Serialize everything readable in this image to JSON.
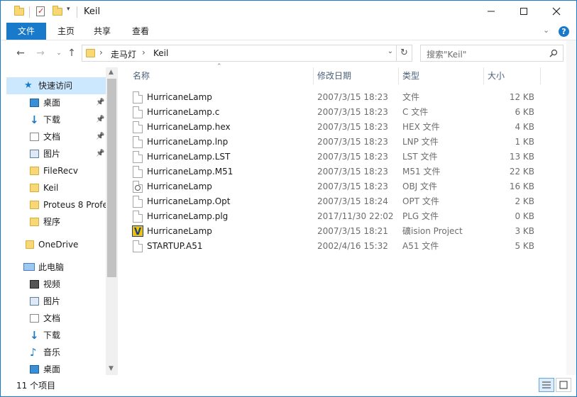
{
  "window": {
    "title": "Keil"
  },
  "ribbon": {
    "tabs": [
      "文件",
      "主页",
      "共享",
      "查看"
    ]
  },
  "address": {
    "segments": [
      "走马灯",
      "Keil"
    ]
  },
  "search": {
    "placeholder": "搜索\"Keil\""
  },
  "nav": {
    "quick_access": "快速访问",
    "items": [
      {
        "label": "桌面",
        "icon": "desktop-icon",
        "pinned": true
      },
      {
        "label": "下载",
        "icon": "download-icon",
        "pinned": true
      },
      {
        "label": "文档",
        "icon": "document-icon",
        "pinned": true
      },
      {
        "label": "图片",
        "icon": "picture-icon",
        "pinned": true
      },
      {
        "label": "FileRecv",
        "icon": "folder-icon",
        "pinned": false
      },
      {
        "label": "Keil",
        "icon": "folder-icon",
        "pinned": false
      },
      {
        "label": "Proteus 8 Profe",
        "icon": "folder-icon",
        "pinned": false
      },
      {
        "label": "程序",
        "icon": "folder-icon",
        "pinned": false
      }
    ],
    "onedrive": "OneDrive",
    "this_pc": "此电脑",
    "pc_items": [
      {
        "label": "视频",
        "icon": "video-icon"
      },
      {
        "label": "图片",
        "icon": "picture-icon"
      },
      {
        "label": "文档",
        "icon": "document-icon"
      },
      {
        "label": "下载",
        "icon": "download-icon"
      },
      {
        "label": "音乐",
        "icon": "music-icon"
      },
      {
        "label": "桌面",
        "icon": "desktop-icon"
      }
    ]
  },
  "columns": {
    "name": "名称",
    "date": "修改日期",
    "type": "类型",
    "size": "大小"
  },
  "files": [
    {
      "name": "HurricaneLamp",
      "date": "2007/3/15 18:23",
      "type": "文件",
      "size": "12 KB",
      "icon": "file-icon"
    },
    {
      "name": "HurricaneLamp.c",
      "date": "2007/3/15 18:23",
      "type": "C 文件",
      "size": "6 KB",
      "icon": "file-icon"
    },
    {
      "name": "HurricaneLamp.hex",
      "date": "2007/3/15 18:23",
      "type": "HEX 文件",
      "size": "4 KB",
      "icon": "file-icon"
    },
    {
      "name": "HurricaneLamp.lnp",
      "date": "2007/3/15 18:23",
      "type": "LNP 文件",
      "size": "1 KB",
      "icon": "file-icon"
    },
    {
      "name": "HurricaneLamp.LST",
      "date": "2007/3/15 18:23",
      "type": "LST 文件",
      "size": "13 KB",
      "icon": "file-icon"
    },
    {
      "name": "HurricaneLamp.M51",
      "date": "2007/3/15 18:23",
      "type": "M51 文件",
      "size": "22 KB",
      "icon": "file-icon"
    },
    {
      "name": "HurricaneLamp",
      "date": "2007/3/15 18:23",
      "type": "OBJ 文件",
      "size": "16 KB",
      "icon": "obj-file-icon"
    },
    {
      "name": "HurricaneLamp.Opt",
      "date": "2007/3/15 18:24",
      "type": "OPT 文件",
      "size": "2 KB",
      "icon": "file-icon"
    },
    {
      "name": "HurricaneLamp.plg",
      "date": "2017/11/30 22:02",
      "type": "PLG 文件",
      "size": "0 KB",
      "icon": "file-icon"
    },
    {
      "name": "HurricaneLamp",
      "date": "2007/3/15 18:21",
      "type": "礦ision Project",
      "size": "3 KB",
      "icon": "uvision-project-icon"
    },
    {
      "name": "STARTUP.A51",
      "date": "2002/4/16 15:32",
      "type": "A51 文件",
      "size": "5 KB",
      "icon": "file-icon"
    }
  ],
  "status": {
    "count": "11 个项目"
  },
  "colors": {
    "accent": "#1979ca",
    "selected_bg": "#cce8ff",
    "folder": "#f8d775"
  }
}
